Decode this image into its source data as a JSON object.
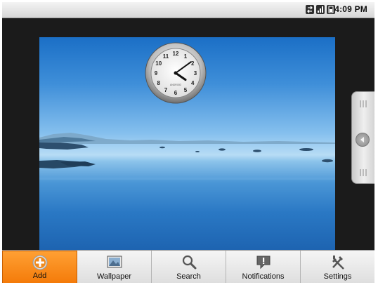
{
  "status_bar": {
    "time": "4:09 PM",
    "icons": [
      "sync-icon",
      "signal-icon",
      "battery-icon"
    ]
  },
  "clock_widget": {
    "hour": 4,
    "minute": 9,
    "brand": "ANDROID",
    "numerals": [
      "12",
      "1",
      "2",
      "3",
      "4",
      "5",
      "6",
      "7",
      "8",
      "9",
      "10",
      "11"
    ]
  },
  "menu": {
    "items": [
      {
        "label": "Add",
        "icon": "add-icon",
        "active": true
      },
      {
        "label": "Wallpaper",
        "icon": "wallpaper-icon",
        "active": false
      },
      {
        "label": "Search",
        "icon": "search-icon",
        "active": false
      },
      {
        "label": "Notifications",
        "icon": "notifications-icon",
        "active": false
      },
      {
        "label": "Settings",
        "icon": "settings-icon",
        "active": false
      }
    ]
  },
  "colors": {
    "active_menu": "#f47b0a",
    "status_bar": "#e4e4e4"
  }
}
